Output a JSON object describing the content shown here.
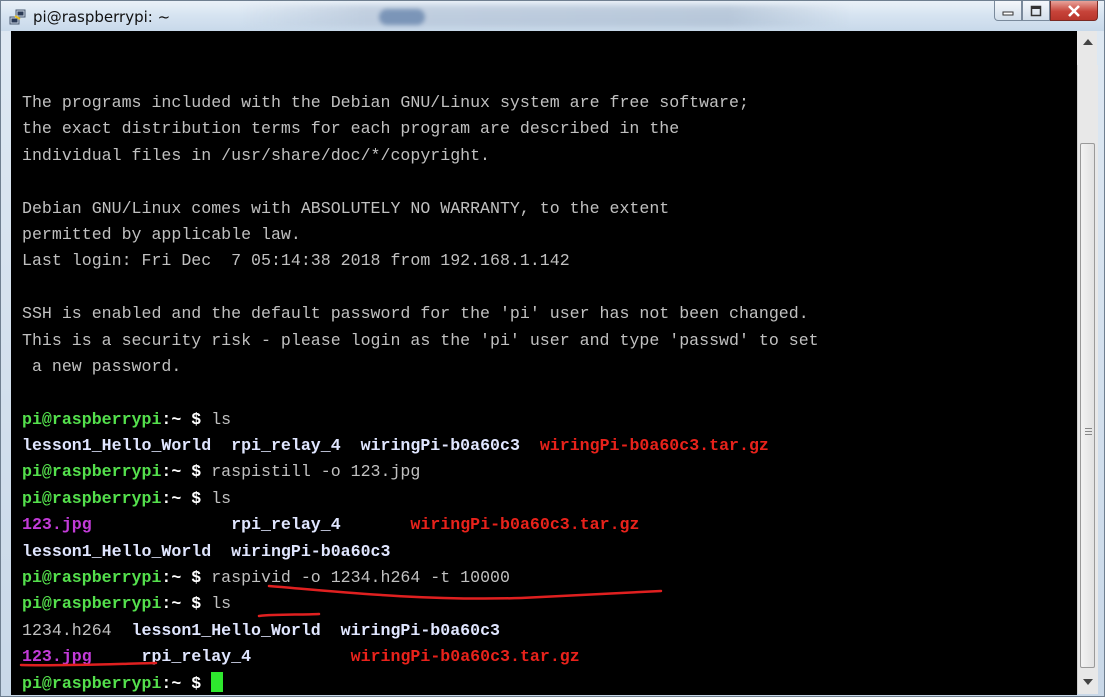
{
  "window": {
    "title": "pi@raspberrypi: ~"
  },
  "terminal": {
    "lines": [
      {
        "segments": [
          {
            "text": "The programs included with the Debian GNU/Linux system are free software;",
            "color": "gray"
          }
        ]
      },
      {
        "segments": [
          {
            "text": "the exact distribution terms for each program are described in the",
            "color": "gray"
          }
        ]
      },
      {
        "segments": [
          {
            "text": "individual files in /usr/share/doc/*/copyright.",
            "color": "gray"
          }
        ]
      },
      {
        "segments": [
          {
            "text": "",
            "color": "gray"
          }
        ]
      },
      {
        "segments": [
          {
            "text": "Debian GNU/Linux comes with ABSOLUTELY NO WARRANTY, to the extent",
            "color": "gray"
          }
        ]
      },
      {
        "segments": [
          {
            "text": "permitted by applicable law.",
            "color": "gray"
          }
        ]
      },
      {
        "segments": [
          {
            "text": "Last login: Fri Dec  7 05:14:38 2018 from 192.168.1.142",
            "color": "gray"
          }
        ]
      },
      {
        "segments": [
          {
            "text": "",
            "color": "gray"
          }
        ]
      },
      {
        "segments": [
          {
            "text": "SSH is enabled and the default password for the 'pi' user has not been changed.",
            "color": "gray"
          }
        ]
      },
      {
        "segments": [
          {
            "text": "This is a security risk - please login as the 'pi' user and type 'passwd' to set",
            "color": "gray"
          }
        ]
      },
      {
        "segments": [
          {
            "text": " a new password.",
            "color": "gray"
          }
        ]
      },
      {
        "segments": [
          {
            "text": "",
            "color": "gray"
          }
        ]
      },
      {
        "segments": [
          {
            "text": "pi@raspberrypi",
            "color": "green"
          },
          {
            "text": ":~ $ ",
            "color": "white"
          },
          {
            "text": "ls",
            "color": "gray"
          }
        ]
      },
      {
        "segments": [
          {
            "text": "lesson1_Hello_World",
            "color": "blue"
          },
          {
            "text": "  ",
            "color": "gray"
          },
          {
            "text": "rpi_relay_4",
            "color": "blue"
          },
          {
            "text": "  ",
            "color": "gray"
          },
          {
            "text": "wiringPi-b0a60c3",
            "color": "blue"
          },
          {
            "text": "  ",
            "color": "gray"
          },
          {
            "text": "wiringPi-b0a60c3.tar.gz",
            "color": "red"
          }
        ]
      },
      {
        "segments": [
          {
            "text": "pi@raspberrypi",
            "color": "green"
          },
          {
            "text": ":~ $ ",
            "color": "white"
          },
          {
            "text": "raspistill -o 123.jpg",
            "color": "gray"
          }
        ]
      },
      {
        "segments": [
          {
            "text": "pi@raspberrypi",
            "color": "green"
          },
          {
            "text": ":~ $ ",
            "color": "white"
          },
          {
            "text": "ls",
            "color": "gray"
          }
        ]
      },
      {
        "segments": [
          {
            "text": "123.jpg",
            "color": "magenta"
          },
          {
            "text": "              ",
            "color": "gray"
          },
          {
            "text": "rpi_relay_4",
            "color": "blue"
          },
          {
            "text": "       ",
            "color": "gray"
          },
          {
            "text": "wiringPi-b0a60c3.tar.gz",
            "color": "red"
          }
        ]
      },
      {
        "segments": [
          {
            "text": "lesson1_Hello_World",
            "color": "blue"
          },
          {
            "text": "  ",
            "color": "gray"
          },
          {
            "text": "wiringPi-b0a60c3",
            "color": "blue"
          }
        ]
      },
      {
        "segments": [
          {
            "text": "pi@raspberrypi",
            "color": "green"
          },
          {
            "text": ":~ $ ",
            "color": "white"
          },
          {
            "text": "raspivid -o 1234.h264 -t 10000",
            "color": "gray"
          }
        ]
      },
      {
        "segments": [
          {
            "text": "pi@raspberrypi",
            "color": "green"
          },
          {
            "text": ":~ $ ",
            "color": "white"
          },
          {
            "text": "ls",
            "color": "gray"
          }
        ]
      },
      {
        "segments": [
          {
            "text": "1234.h264",
            "color": "gray"
          },
          {
            "text": "  ",
            "color": "gray"
          },
          {
            "text": "lesson1_Hello_World",
            "color": "blue"
          },
          {
            "text": "  ",
            "color": "gray"
          },
          {
            "text": "wiringPi-b0a60c3",
            "color": "blue"
          }
        ]
      },
      {
        "segments": [
          {
            "text": "123.jpg",
            "color": "magenta"
          },
          {
            "text": "     ",
            "color": "gray"
          },
          {
            "text": "rpi_relay_4",
            "color": "blue"
          },
          {
            "text": "          ",
            "color": "gray"
          },
          {
            "text": "wiringPi-b0a60c3.tar.gz",
            "color": "red"
          }
        ]
      },
      {
        "segments": [
          {
            "text": "pi@raspberrypi",
            "color": "green"
          },
          {
            "text": ":~ $ ",
            "color": "white"
          }
        ]
      }
    ]
  },
  "colors": {
    "background": "#000000",
    "prompt": "#54e04c",
    "annotation": "#e02020"
  }
}
